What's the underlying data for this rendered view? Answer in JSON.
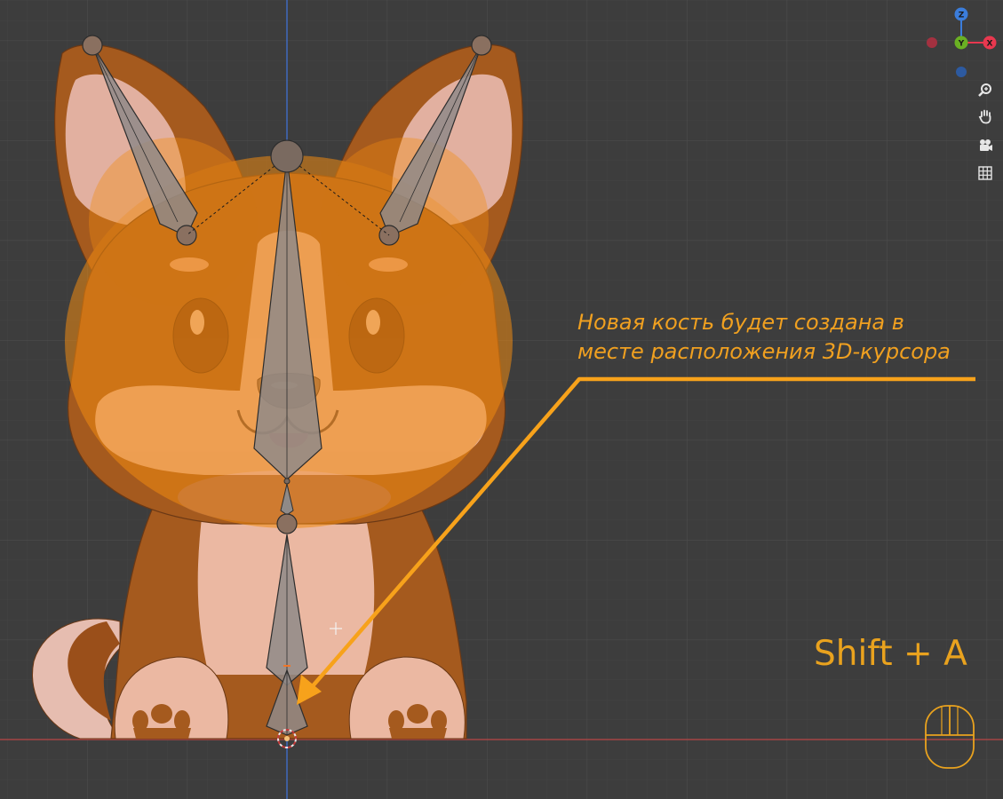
{
  "annotation": {
    "line1": "Новая кость будет создана в",
    "line2": "месте расположения 3D-курсора",
    "color": "#f7a21b"
  },
  "shortcut": {
    "label": "Shift + A",
    "color": "#e9a21e"
  },
  "gizmo": {
    "z_label": "Z",
    "y_label": "Y",
    "x_label": "X",
    "x_color": "#e8384f",
    "y_color": "#6ab023",
    "z_color": "#3b7ddb"
  },
  "nav_tools": [
    {
      "icon": "zoom-icon"
    },
    {
      "icon": "hand-pan-icon"
    },
    {
      "icon": "camera-icon"
    },
    {
      "icon": "grid-icon"
    }
  ],
  "colors": {
    "background": "#3d3d3d",
    "dog_brown": "#a55a1e",
    "dog_light": "#e9b8a0",
    "bone_fill": "#8a8684",
    "highlight_orange": "#e38a17"
  }
}
